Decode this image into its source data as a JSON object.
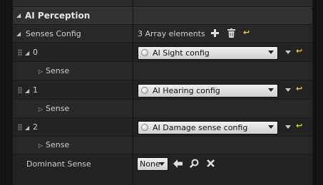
{
  "category": {
    "title": "AI Perception"
  },
  "senses_config": {
    "label": "Senses Config",
    "summary": "3 Array elements",
    "elements": [
      {
        "index": "0",
        "value": "AI Sight config",
        "child_label": "Sense"
      },
      {
        "index": "1",
        "value": "AI Hearing config",
        "child_label": "Sense"
      },
      {
        "index": "2",
        "value": "AI Damage sense config",
        "child_label": "Sense"
      }
    ]
  },
  "dominant_sense": {
    "label": "Dominant Sense",
    "value": "None"
  },
  "icons": {
    "add": "plus-icon",
    "clear": "trash-icon",
    "reset": "reset-arrow-icon",
    "browse": "arrow-left-icon",
    "search": "magnifier-icon",
    "clear_value": "x-icon"
  },
  "colors": {
    "reset_arrow": "#e3d23a",
    "combo_bg": "#e6e6e6"
  }
}
